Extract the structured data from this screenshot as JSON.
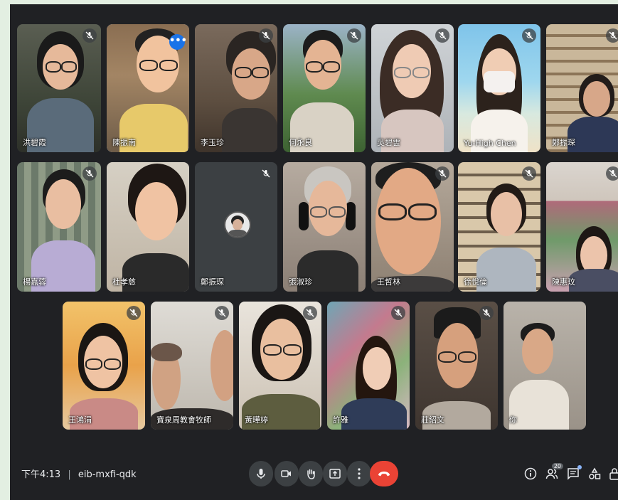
{
  "participants": [
    {
      "name": "洪碧霞"
    },
    {
      "name": "陳振南"
    },
    {
      "name": "李玉珍"
    },
    {
      "name": "何永良"
    },
    {
      "name": "吳碧雲"
    },
    {
      "name": "Yu-High Chen"
    },
    {
      "name": "鄭振琛"
    },
    {
      "name": "楊嘉蓉"
    },
    {
      "name": "杜孝慈"
    },
    {
      "name": "鄭振琛"
    },
    {
      "name": "張淑珍"
    },
    {
      "name": "王哲林"
    },
    {
      "name": "徐悅倫"
    },
    {
      "name": "陳惠玟"
    },
    {
      "name": "王鴻涓"
    },
    {
      "name": "寶泉周教會牧師"
    },
    {
      "name": "黃曄婷"
    },
    {
      "name": "許雅"
    },
    {
      "name": "莊紹文"
    },
    {
      "name": "你"
    }
  ],
  "bottom_bar": {
    "time": "下午4:13",
    "separator": "|",
    "meeting_code": "eib-mxfi-qdk",
    "people_count": "20"
  },
  "colors": {
    "background": "#202124",
    "tile": "#3c4043",
    "end_call": "#ea4335",
    "active_speaker": "#8ab4f8"
  }
}
